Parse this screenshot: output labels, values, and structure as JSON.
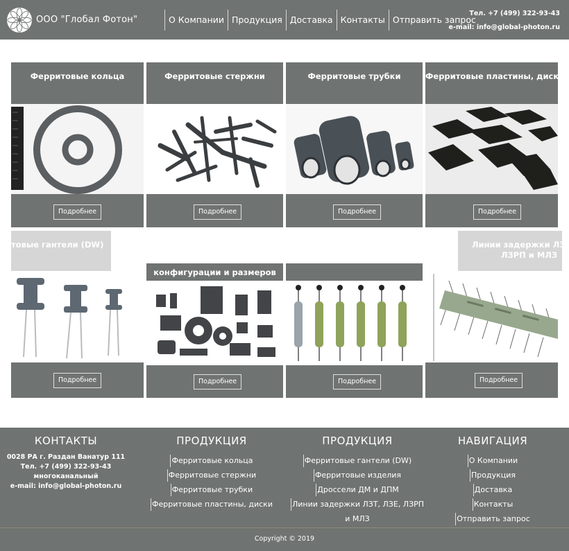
{
  "header": {
    "brand": "ООО \"Глобал Фотон\"",
    "nav": [
      "О Компании",
      "Продукция",
      "Доставка",
      "Контакты",
      "Отправить запрос"
    ],
    "phone": "Тел. +7 (499) 322-93-43",
    "email": "e-mail: info@global-photon.ru"
  },
  "cards": [
    {
      "title": "Ферритовые кольца",
      "button": "Подробнее"
    },
    {
      "title": "Ферритовые стержни",
      "button": "Подробнее"
    },
    {
      "title": "Ферритовые трубки",
      "button": "Подробнее"
    },
    {
      "title": "Ферритовые пластины, диски",
      "button": "Подробнее"
    },
    {
      "title": "товые гантели (DW)",
      "button": "Подробнее"
    },
    {
      "title": "конфигурации и размеров",
      "button": "Подробнее"
    },
    {
      "title": "",
      "button": "Подробнее"
    },
    {
      "title_line1": "Линии задержки ЛЗТ",
      "title_line2": "ЛЗРП и МЛЗ",
      "button": "Подробнее"
    }
  ],
  "footer": {
    "contacts": {
      "heading": "КОНТАКТЫ",
      "address": "0028 РА г. Раздан Ванатур 111",
      "phone": "Тел. +7 (499) 322-93-43",
      "phone_note": "многоканальный",
      "email": "e-mail: info@global-photon.ru"
    },
    "products1": {
      "heading": "ПРОДУКЦИЯ",
      "links": [
        "Ферритовые кольца",
        "Ферритовые стержни",
        "Ферритовые трубки",
        "Ферритовые пластины, диски"
      ]
    },
    "products2": {
      "heading": "ПРОДУКЦИЯ",
      "links": [
        "Ферритовые гантели (DW)",
        "Ферритовые изделия",
        "Дроссели ДМ и ДПМ",
        "Линии задержки ЛЗТ, ЛЗЕ, ЛЗРП",
        "и МЛЗ"
      ]
    },
    "navigation": {
      "heading": "НАВИГАЦИЯ",
      "links": [
        "О Компании",
        "Продукция",
        "Доставка",
        "Контакты",
        "Отправить запрос"
      ]
    },
    "copyright": "Copyright © 2019"
  }
}
